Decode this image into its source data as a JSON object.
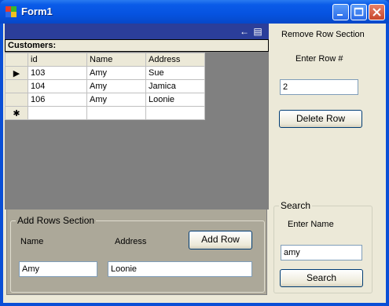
{
  "window": {
    "title": "Form1"
  },
  "grid": {
    "caption": "Customers:",
    "columns": [
      "id",
      "Name",
      "Address"
    ],
    "rows": [
      [
        "103",
        "Amy",
        "Sue"
      ],
      [
        "104",
        "Amy",
        "Jamica"
      ],
      [
        "106",
        "Amy",
        "Loonie"
      ]
    ],
    "current_row_marker": "▶",
    "new_row_marker": "✱"
  },
  "remove_section": {
    "title": "Remove Row Section",
    "row_label": "Enter Row #",
    "row_value": "2",
    "delete_label": "Delete Row"
  },
  "add_section": {
    "title": "Add Rows Section",
    "name_label": "Name",
    "address_label": "Address",
    "add_label": "Add Row",
    "name_value": "Amy",
    "address_value": "Loonie"
  },
  "search_section": {
    "title": "Search",
    "name_label": "Enter Name",
    "name_value": "amy",
    "search_label": "Search"
  }
}
